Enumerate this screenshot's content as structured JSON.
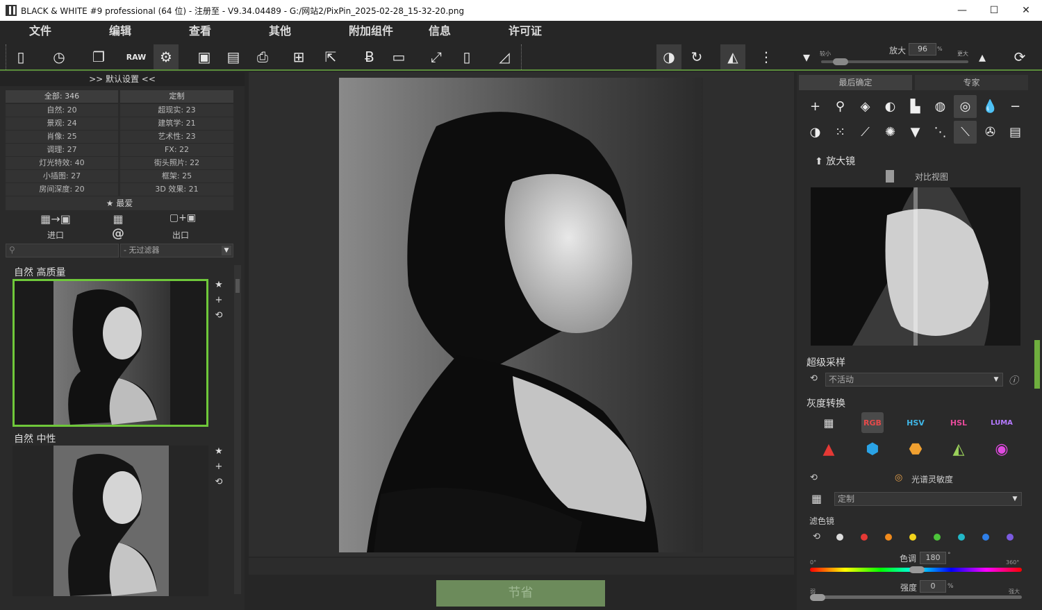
{
  "window": {
    "title": "BLACK & WHITE #9 professional (64 位) - 注册至 - V9.34.04489 - G:/网站2/PixPin_2025-02-28_15-32-20.png",
    "minimize": "—",
    "maximize": "☐",
    "close": "✕"
  },
  "menu": [
    "文件",
    "编辑",
    "查看",
    "其他",
    "附加组件",
    "信息",
    "许可证"
  ],
  "toolbar": {
    "zoom_label": "放大",
    "zoom_value": "96",
    "zoom_unit": "%",
    "zoom_min": "较小",
    "zoom_max": "更大"
  },
  "left": {
    "header": ">> 默认设置 <<",
    "all": "全部: 346",
    "custom": "定制",
    "cats_left": [
      "自然: 20",
      "景观: 24",
      "肖像: 25",
      "调理: 27",
      "灯光特效: 40",
      "小插图: 27",
      "房间深度: 20"
    ],
    "cats_right": [
      "超现实: 23",
      "建筑学: 21",
      "艺术性: 23",
      "FX: 22",
      "街头照片: 22",
      "框架: 25",
      "3D 效果: 21"
    ],
    "favorites": "★ 最爱",
    "import_label": "进口",
    "export_label": "出口",
    "at_symbol": "@",
    "filter": "- 无过滤器",
    "presets": [
      {
        "title": "自然  高质量"
      },
      {
        "title": "自然  中性"
      }
    ]
  },
  "center": {
    "save_label": "节省"
  },
  "right": {
    "tab_final": "最后确定",
    "tab_expert": "专家",
    "magnifier": "放大镜",
    "compare_view": "对比视图",
    "supersampling": "超级采样",
    "supersampling_value": "不活动",
    "grayscale": "灰度转换",
    "spectral": "光谱灵敏度",
    "custom_value": "定制",
    "filter_label": "滤色镜",
    "hue_label": "色调",
    "hue_value": "180",
    "hue_min": "0°",
    "hue_max": "360°",
    "strength_label": "强度",
    "strength_value": "0",
    "strength_unit": "%",
    "strength_min": "弱",
    "strength_max": "强大",
    "gs_labels": [
      "RGB",
      "HSV",
      "HSL",
      "LUMA"
    ],
    "filter_colors": [
      "#dddddd",
      "#e53935",
      "#f08a1c",
      "#f2d31b",
      "#4cc43a",
      "#22b8c8",
      "#2f7fe8",
      "#7b5be0"
    ]
  }
}
